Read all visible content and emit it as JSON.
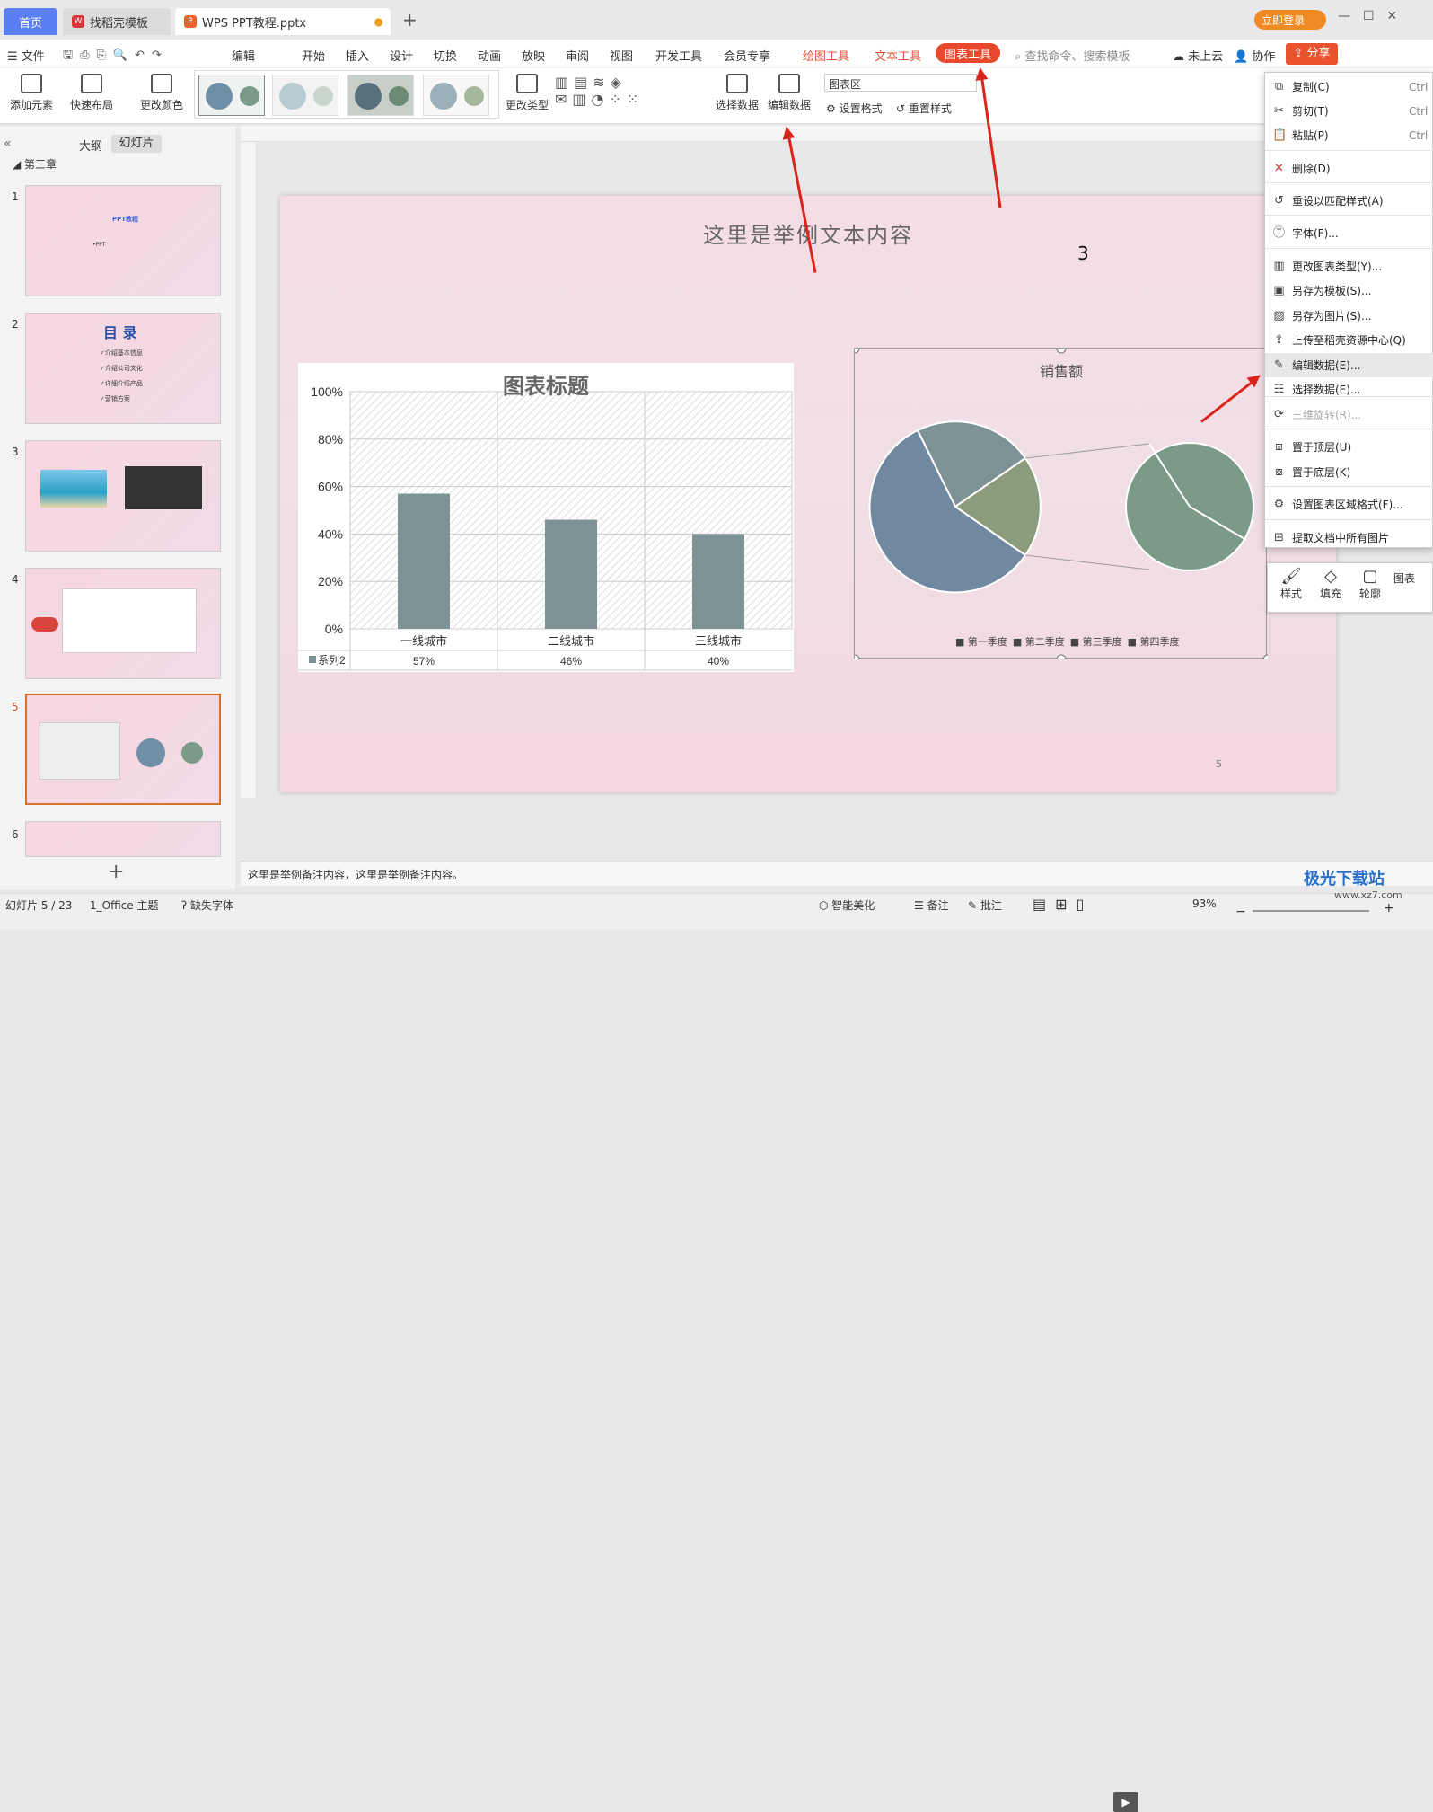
{
  "tabs": {
    "home": "首页",
    "template": "找稻壳模板",
    "file": "WPS PPT教程.pptx"
  },
  "header": {
    "login": "立即登录"
  },
  "menu": {
    "file": "文件",
    "edit": "编辑",
    "items": [
      "开始",
      "插入",
      "设计",
      "切换",
      "动画",
      "放映",
      "审阅",
      "视图",
      "开发工具",
      "会员专享"
    ],
    "draw_tool": "绘图工具",
    "text_tool": "文本工具",
    "chart_tool": "图表工具",
    "search": "查找命令、搜索模板",
    "cloud": "未上云",
    "collab": "协作",
    "share": "分享"
  },
  "ribbon": {
    "add_element": "添加元素",
    "quick_layout": "快速布局",
    "change_color": "更改颜色",
    "change_type": "更改类型",
    "select_data": "选择数据",
    "edit_data": "编辑数据",
    "chart_area": "图表区",
    "set_format": "设置格式",
    "reset_style": "重置样式"
  },
  "panel": {
    "outline": "大纲",
    "slides": "幻灯片",
    "section": "第三章",
    "slide_numbers": [
      "1",
      "2",
      "3",
      "4",
      "5",
      "6"
    ],
    "s1_title": "PPT教程",
    "s1_sub": "•PPT",
    "s2_title": "目 录",
    "s2_items": [
      "✓介绍基本信息",
      "✓介绍公司文化",
      "✓详细介绍产品",
      "✓营销方案"
    ]
  },
  "slide": {
    "title": "这里是举例文本内容",
    "number": "3",
    "page": "5"
  },
  "bar_chart": {
    "title": "图表标题",
    "type": "bar",
    "categories": [
      "一线城市",
      "二线城市",
      "三线城市"
    ],
    "values": [
      57,
      46,
      40
    ],
    "value_labels": [
      "57%",
      "46%",
      "40%"
    ],
    "series_name": "系列2",
    "y_ticks": [
      "100%",
      "80%",
      "60%",
      "40%",
      "20%",
      "0%"
    ],
    "ylim": [
      0,
      100
    ],
    "color": "#7d9294"
  },
  "pie_chart": {
    "title": "销售额",
    "legend": [
      "第一季度",
      "第二季度",
      "第三季度",
      "第四季度"
    ]
  },
  "chart_data": [
    {
      "type": "bar",
      "title": "图表标题",
      "categories": [
        "一线城市",
        "二线城市",
        "三线城市"
      ],
      "series": [
        {
          "name": "系列2",
          "values": [
            57,
            46,
            40
          ]
        }
      ],
      "ylim": [
        0,
        100
      ]
    },
    {
      "type": "pie",
      "title": "销售额",
      "categories": [
        "第一季度",
        "第二季度",
        "第三季度",
        "第四季度"
      ]
    }
  ],
  "context_menu": [
    {
      "label": "复制(C)",
      "shortcut": "Ctrl",
      "icon": "copy-icon"
    },
    {
      "label": "剪切(T)",
      "shortcut": "Ctrl",
      "icon": "cut-icon"
    },
    {
      "label": "粘贴(P)",
      "shortcut": "Ctrl",
      "icon": "paste-icon"
    },
    {
      "label": "删除(D)",
      "icon": "delete-icon"
    },
    {
      "label": "重设以匹配样式(A)",
      "icon": "reset-icon"
    },
    {
      "label": "字体(F)...",
      "icon": "font-icon"
    },
    {
      "label": "更改图表类型(Y)...",
      "icon": "chart-type-icon"
    },
    {
      "label": "另存为模板(S)...",
      "icon": "template-icon"
    },
    {
      "label": "另存为图片(S)...",
      "icon": "image-icon"
    },
    {
      "label": "上传至稻壳资源中心(Q)",
      "icon": "upload-icon"
    },
    {
      "label": "编辑数据(E)...",
      "icon": "edit-data-icon"
    },
    {
      "label": "选择数据(E)...",
      "icon": "select-data-icon"
    },
    {
      "label": "三维旋转(R)...",
      "icon": "rotate-3d-icon"
    },
    {
      "label": "置于顶层(U)",
      "icon": "bring-front-icon"
    },
    {
      "label": "置于底层(K)",
      "icon": "send-back-icon"
    },
    {
      "label": "设置图表区域格式(F)...",
      "icon": "format-area-icon"
    },
    {
      "label": "提取文档中所有图片",
      "icon": "extract-images-icon"
    }
  ],
  "mini_toolbar": {
    "style": "样式",
    "fill": "填充",
    "outline": "轮廓",
    "chart": "图表"
  },
  "notes": "这里是举例备注内容，这里是举例备注内容。",
  "status": {
    "slide": "幻灯片 5 / 23",
    "theme": "1_Office 主题",
    "missing_font": "缺失字体",
    "beautify": "智能美化",
    "notes": "备注",
    "comment": "批注",
    "zoom": "93%"
  },
  "watermark": {
    "text": "极光下载站",
    "url": "www.xz7.com"
  }
}
